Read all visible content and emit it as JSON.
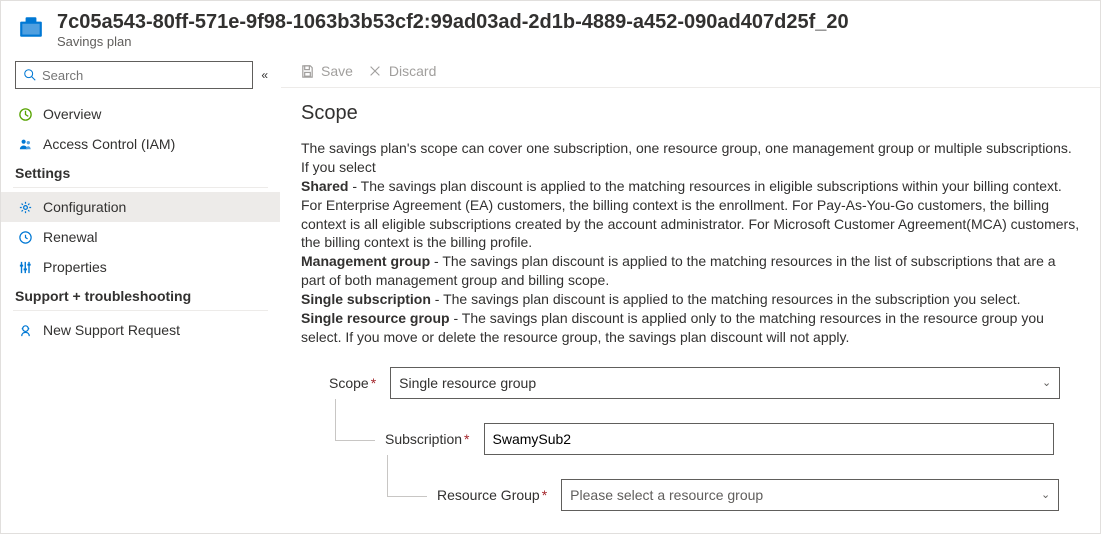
{
  "header": {
    "title": "7c05a543-80ff-571e-9f98-1063b3b53cf2:99ad03ad-2d1b-4889-a452-090ad407d25f_20",
    "subtitle": "Savings plan"
  },
  "search": {
    "placeholder": "Search"
  },
  "nav": {
    "top": [
      {
        "label": "Overview",
        "icon": "overview"
      },
      {
        "label": "Access Control (IAM)",
        "icon": "iam"
      }
    ],
    "settings_label": "Settings",
    "settings": [
      {
        "label": "Configuration",
        "icon": "config",
        "selected": true
      },
      {
        "label": "Renewal",
        "icon": "renewal"
      },
      {
        "label": "Properties",
        "icon": "properties"
      }
    ],
    "support_label": "Support + troubleshooting",
    "support": [
      {
        "label": "New Support Request",
        "icon": "support"
      }
    ]
  },
  "toolbar": {
    "save_label": "Save",
    "discard_label": "Discard"
  },
  "scope": {
    "title": "Scope",
    "intro": "The savings plan's scope can cover one subscription, one resource group, one management group or multiple subscriptions. If you select",
    "shared_label": "Shared",
    "shared_desc": " - The savings plan discount is applied to the matching resources in eligible subscriptions within your billing context. For Enterprise Agreement (EA) customers, the billing context is the enrollment. For Pay-As-You-Go customers, the billing context is all eligible subscriptions created by the account administrator. For Microsoft Customer Agreement(MCA) customers, the billing context is the billing profile.",
    "mg_label": "Management group",
    "mg_desc": " - The savings plan discount is applied to the matching resources in the list of subscriptions that are a part of both management group and billing scope.",
    "single_sub_label": "Single subscription",
    "single_sub_desc": " - The savings plan discount is applied to the matching resources in the subscription you select.",
    "single_rg_label": "Single resource group",
    "single_rg_desc": " - The savings plan discount is applied only to the matching resources in the resource group you select. If you move or delete the resource group, the savings plan discount will not apply."
  },
  "form": {
    "scope_label": "Scope",
    "scope_value": "Single resource group",
    "subscription_label": "Subscription",
    "subscription_value": "SwamySub2",
    "rg_label": "Resource Group",
    "rg_placeholder": "Please select a resource group"
  }
}
